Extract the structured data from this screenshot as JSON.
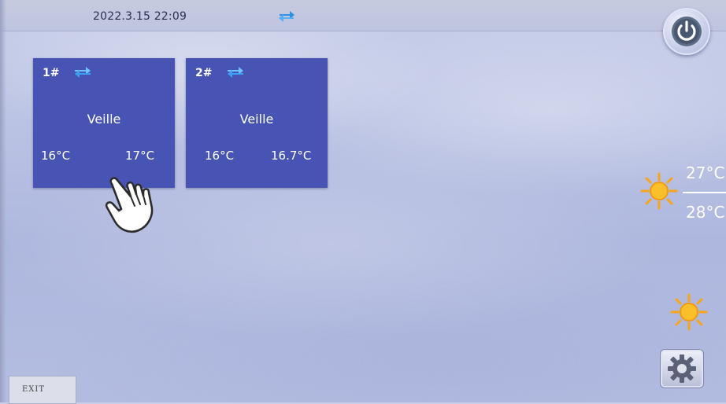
{
  "header": {
    "datetime": "2022.3.15 22:09",
    "mode_icon": "swap-arrows-icon"
  },
  "power": {
    "icon": "power-icon"
  },
  "units": [
    {
      "id": "1#",
      "mode_icon": "swap-arrows-icon",
      "status": "Veille",
      "temp_left": "16°C",
      "temp_right": "17°C"
    },
    {
      "id": "2#",
      "mode_icon": "swap-arrows-icon",
      "status": "Veille",
      "temp_left": "16°C",
      "temp_right": "16.7°C"
    }
  ],
  "weather": {
    "icon": "sun-icon",
    "temp_high": "27°C",
    "temp_low": "28°C"
  },
  "controls": {
    "mode_icon": "sun-icon",
    "settings_icon": "gear-icon",
    "exit_label": "EXIT"
  },
  "colors": {
    "card": "#4854b4",
    "accent_icon": "#2f8fe0",
    "sun": "#f7b51b"
  }
}
